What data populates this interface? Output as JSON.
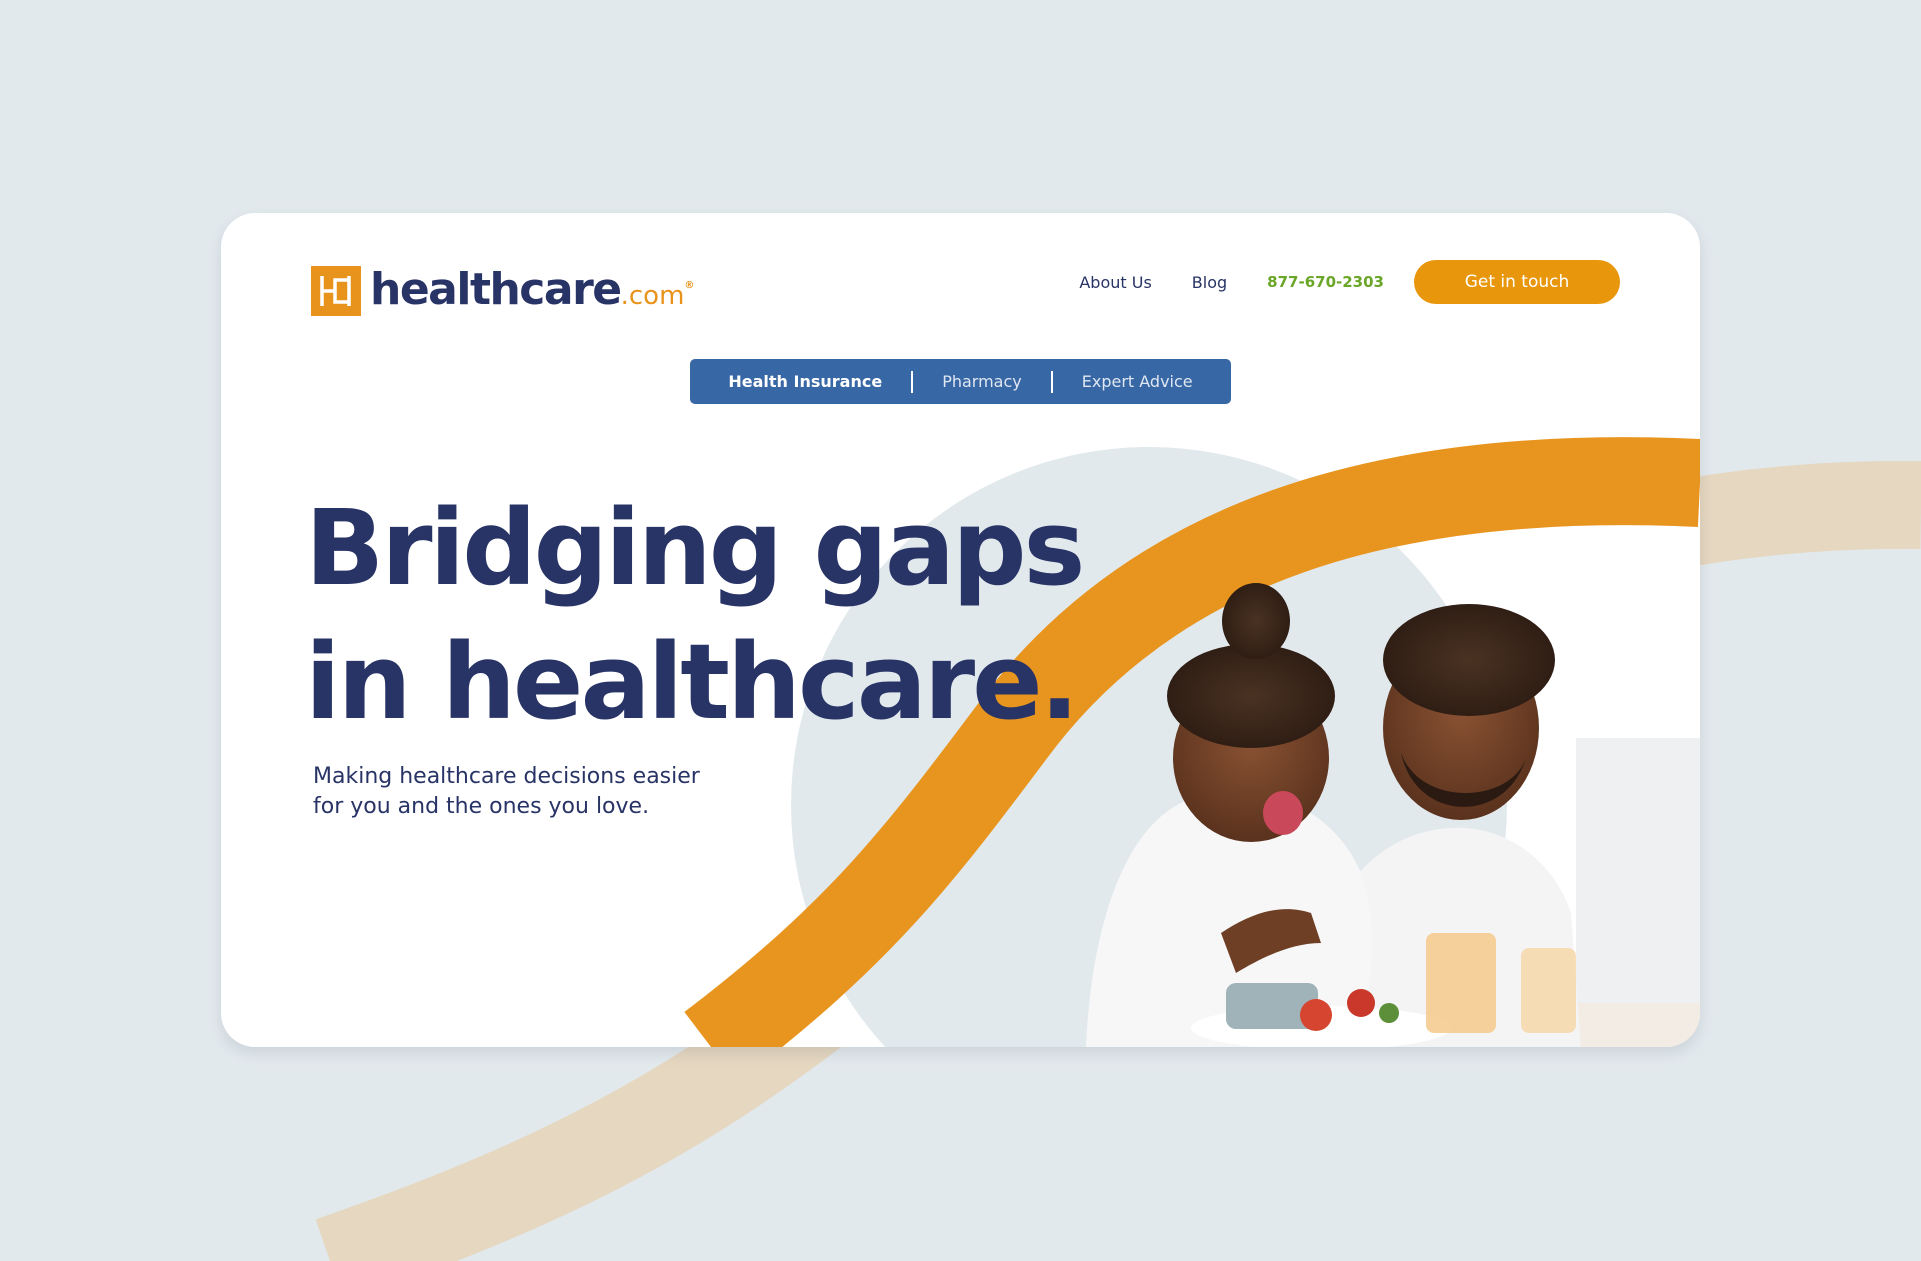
{
  "brand": {
    "name": "healthcare",
    "tld": ".com",
    "registered": "®",
    "colors": {
      "navy": "#283366",
      "orange": "#e8931b",
      "blue": "#3867a5",
      "green": "#6aa627",
      "background": "#e2e9ed"
    }
  },
  "header": {
    "links": [
      {
        "label": "About Us"
      },
      {
        "label": "Blog"
      }
    ],
    "phone": "877-670-2303",
    "cta_label": "Get in touch"
  },
  "subnav": {
    "tabs": [
      {
        "label": "Health Insurance",
        "active": true
      },
      {
        "label": "Pharmacy",
        "active": false
      },
      {
        "label": "Expert Advice",
        "active": false
      }
    ]
  },
  "hero": {
    "headline_line1": "Bridging gaps",
    "headline_line2": "in healthcare.",
    "subhead": "Making healthcare decisions easier for you and the ones you love.",
    "image_icon": "father-and-child-photo"
  }
}
